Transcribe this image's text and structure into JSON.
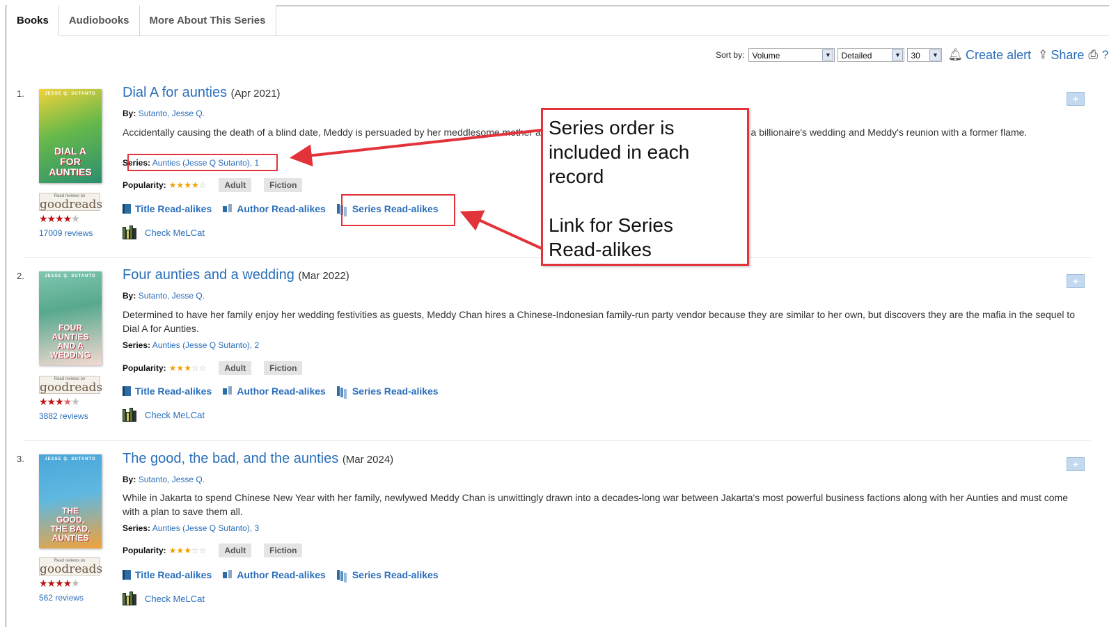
{
  "tabs": [
    {
      "label": "Books",
      "active": true
    },
    {
      "label": "Audiobooks",
      "active": false
    },
    {
      "label": "More About This Series",
      "active": false
    }
  ],
  "toolbar": {
    "sort_label": "Sort by:",
    "sort_value": "Volume",
    "view_value": "Detailed",
    "per_page_value": "30",
    "create_alert": "Create alert",
    "share": "Share"
  },
  "records": [
    {
      "number": "1.",
      "title": "Dial A for aunties",
      "date": "(Apr 2021)",
      "by_label": "By:",
      "author": "Sutanto, Jesse Q.",
      "description": "Accidentally causing the death of a blind date, Meddy is persuaded by her meddlesome mother and aunties to dispose of the body, which upends a billionaire's wedding and Meddy's reunion with a former flame.",
      "series_label": "Series:",
      "series": "Aunties (Jesse Q Sutanto), 1",
      "popularity_label": "Popularity:",
      "popularity": 4,
      "tags": [
        "Adult",
        "Fiction"
      ],
      "goodreads_rating": 4,
      "reviews": "17009 reviews",
      "cover_author": "JESSE Q. SUTANTO",
      "cover_title": "DIAL A\nFOR\nAUNTIES"
    },
    {
      "number": "2.",
      "title": "Four aunties and a wedding",
      "date": "(Mar 2022)",
      "by_label": "By:",
      "author": "Sutanto, Jesse Q.",
      "description": "Determined to have her family enjoy her wedding festivities as guests, Meddy Chan hires a Chinese-Indonesian family-run party vendor because they are similar to her own, but discovers they are the mafia in the sequel to Dial A for Aunties.",
      "series_label": "Series:",
      "series": "Aunties (Jesse Q Sutanto), 2",
      "popularity_label": "Popularity:",
      "popularity": 3,
      "tags": [
        "Adult",
        "Fiction"
      ],
      "goodreads_rating": 3.5,
      "reviews": "3882 reviews",
      "cover_author": "JESSE Q. SUTANTO",
      "cover_title": "FOUR\nAUNTIES\nAND A\nWEDDING"
    },
    {
      "number": "3.",
      "title": "The good, the bad, and the aunties",
      "date": "(Mar 2024)",
      "by_label": "By:",
      "author": "Sutanto, Jesse Q.",
      "description": "While in Jakarta to spend Chinese New Year with her family, newlywed Meddy Chan is unwittingly drawn into a decades-long war between Jakarta's most powerful business factions along with her Aunties and must come with a plan to save them all.",
      "series_label": "Series:",
      "series": "Aunties (Jesse Q Sutanto), 3",
      "popularity_label": "Popularity:",
      "popularity": 3,
      "tags": [
        "Adult",
        "Fiction"
      ],
      "goodreads_rating": 4,
      "reviews": "562 reviews",
      "cover_author": "JESSE Q. SUTANTO",
      "cover_title": "THE\nGOOD,\nTHE BAD,\nAUNTIES"
    }
  ],
  "readalikes": {
    "title": "Title Read-alikes",
    "author": "Author Read-alikes",
    "series": "Series Read-alikes"
  },
  "melcat": "Check MeLCat",
  "goodreads": {
    "top": "Read reviews on",
    "word": "goodreads"
  },
  "callout": {
    "line1": "Series order is",
    "line2": "included in each",
    "line3": "record",
    "line4": "Link for Series",
    "line5": "Read-alikes"
  },
  "colors": {
    "link": "#2a6ebb",
    "annotation": "#e2323a",
    "popularity_star": "#f0a000",
    "goodreads_star": "#b11111"
  }
}
